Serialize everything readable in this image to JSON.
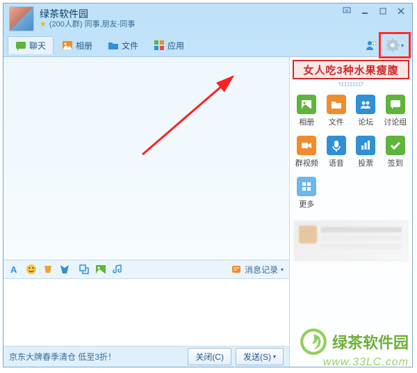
{
  "header": {
    "title": "绿茶软件园",
    "subtitle": "(200人群) 同事,朋友-同事"
  },
  "tabs": {
    "chat": "聊天",
    "album": "相册",
    "files": "文件",
    "apps": "应用"
  },
  "banner_text": "女人吃3种水果瘦腹",
  "sidebar_apps": [
    {
      "label": "相册",
      "bg": "#5fb43a",
      "icon": "image"
    },
    {
      "label": "文件",
      "bg": "#f08c2e",
      "icon": "folder"
    },
    {
      "label": "论坛",
      "bg": "#2f8fd7",
      "icon": "people"
    },
    {
      "label": "讨论组",
      "bg": "#5fb43a",
      "icon": "chat"
    },
    {
      "label": "群视频",
      "bg": "#f08c2e",
      "icon": "video"
    },
    {
      "label": "语音",
      "bg": "#2f8fd7",
      "icon": "mic"
    },
    {
      "label": "投票",
      "bg": "#2f8fd7",
      "icon": "bars"
    },
    {
      "label": "签到",
      "bg": "#5fb43a",
      "icon": "check"
    },
    {
      "label": "更多",
      "bg": "#6fb7ea",
      "icon": "grid"
    }
  ],
  "toolbar": {
    "message_log": "消息记录"
  },
  "footer": {
    "ad": "京东大牌春季清仓 低至3折！",
    "close": "关闭(C)",
    "send": "发送(S)"
  },
  "watermark": {
    "brand": "绿茶软件园",
    "url": "www.33LC.com"
  }
}
